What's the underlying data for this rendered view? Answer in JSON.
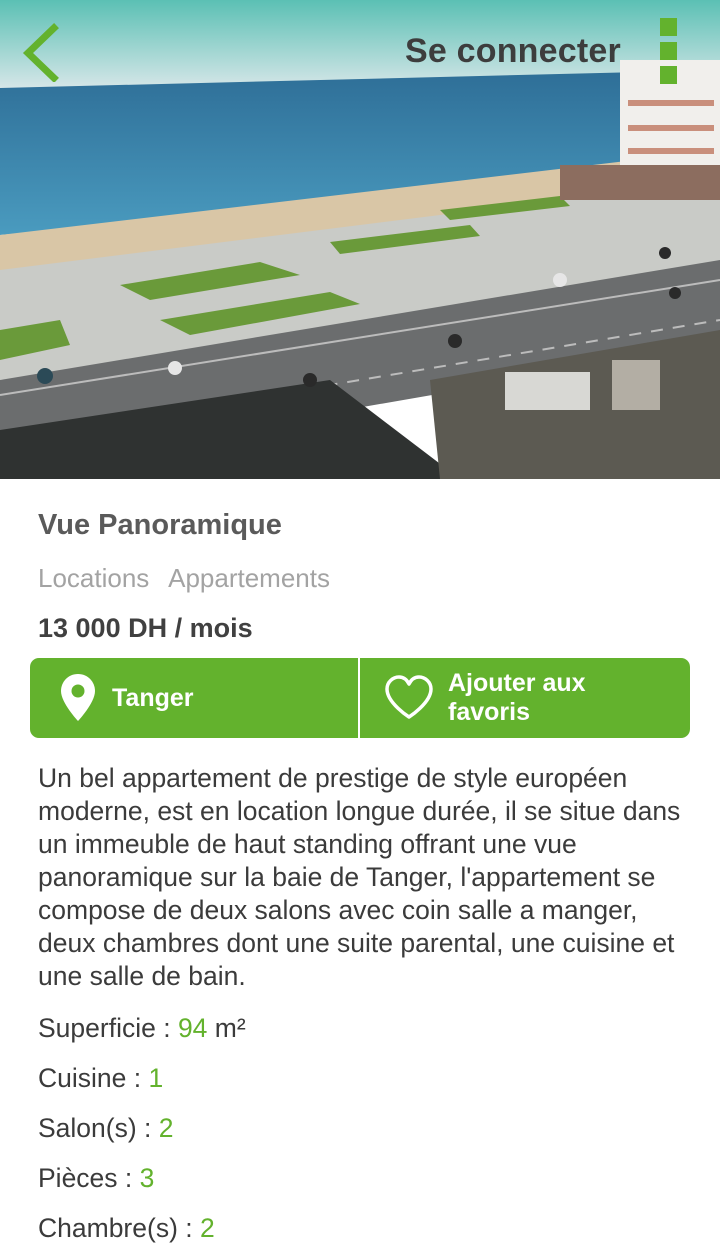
{
  "header": {
    "login_label": "Se connecter"
  },
  "listing": {
    "title": "Vue Panoramique",
    "categories": [
      "Locations",
      "Appartements"
    ],
    "price": "13 000 DH / mois",
    "city": "Tanger",
    "favorite_label": "Ajouter aux favoris",
    "description": "Un bel appartement de prestige de style européen moderne, est en location longue durée, il se situe dans un immeuble de haut standing offrant une vue panoramique sur la baie de Tanger, l'appartement se compose de deux salons avec coin salle a manger, deux chambres dont une suite parental, une cuisine et une salle de bain."
  },
  "specs": [
    {
      "label": "Superficie : ",
      "value": "94",
      "unit": " m²"
    },
    {
      "label": "Cuisine : ",
      "value": "1",
      "unit": ""
    },
    {
      "label": "Salon(s) : ",
      "value": "2",
      "unit": ""
    },
    {
      "label": "Pièces : ",
      "value": "3",
      "unit": ""
    },
    {
      "label": "Chambre(s) : ",
      "value": "2",
      "unit": ""
    }
  ],
  "icons": {
    "back": "chevron-left-icon",
    "menu": "overflow-menu-icon",
    "location": "map-pin-icon",
    "favorite": "heart-outline-icon"
  },
  "colors": {
    "accent": "#63b22d",
    "title": "#5a5a5a",
    "category": "#a3a3a3",
    "text": "#3b3b3b"
  }
}
